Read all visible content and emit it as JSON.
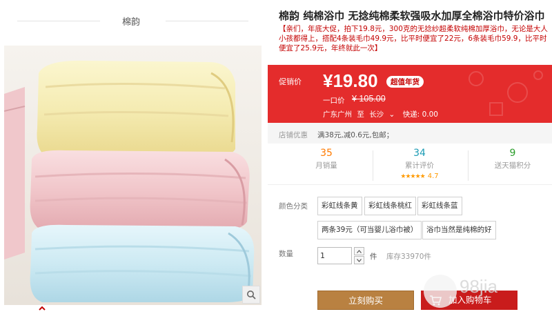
{
  "brand": {
    "name": "棉韵"
  },
  "product": {
    "title": "棉韵 纯棉浴巾 无捻纯棉柔软强吸水加厚全棉浴巾特价浴巾",
    "description": "【亲们，年底大促，拍下19.8元，300克的无捻纱超柔软纯棉加厚浴巾，无论是大人小孩都得上，搭配4条装毛巾49.9元，比平时便宜了22元，6条装毛巾59.9，比平时便宜了25.9元，年终就此一次】"
  },
  "price": {
    "label": "促销价",
    "value": "¥19.80",
    "badge": "超值年货",
    "original_label": "一口价",
    "original_value": "¥ 105.00",
    "ship_from": "广东广州",
    "ship_to_word": "至",
    "ship_to": "长沙",
    "ship_fee": "快递: 0.00"
  },
  "promo": {
    "label": "店铺优惠",
    "text": "满38元,减0.6元,包邮；"
  },
  "stats": {
    "monthly_sales": {
      "value": "35",
      "label": "月销量"
    },
    "reviews": {
      "value": "34",
      "label": "累计评价",
      "stars": "★★★★★",
      "rating": "4.7"
    },
    "points": {
      "value": "9",
      "label": "送天猫积分"
    }
  },
  "options": {
    "label": "颜色分类",
    "items": [
      "彩虹线条黄",
      "彩虹线条桃红",
      "彩虹线条蓝",
      "两条39元（可当婴儿浴巾被）",
      "浴巾当然是纯棉的好"
    ]
  },
  "quantity": {
    "label": "数量",
    "value": "1",
    "unit": "件",
    "stock": "库存33970件"
  },
  "actions": {
    "buy": "立刻购买",
    "cart": "加入购物车"
  },
  "watermark": {
    "text": "98jia"
  },
  "colors": {
    "price_bg": "#e42c2c",
    "buy": "#b98141",
    "cart": "#c91c1c",
    "desc": "#c40000"
  },
  "icons": [
    "search-icon",
    "chevron-up-icon",
    "cart-icon",
    "chevron-up-small-icon",
    "chevron-down-small-icon"
  ]
}
